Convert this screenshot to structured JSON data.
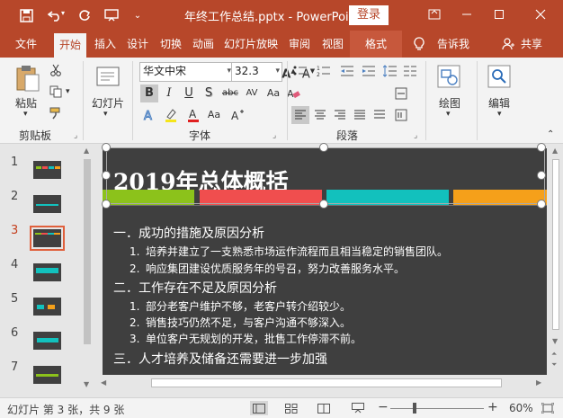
{
  "titlebar": {
    "doc_title": "年终工作总结.pptx  -  PowerPoint",
    "login": "登录",
    "qat_icons": [
      "save-icon",
      "undo-icon",
      "redo-icon",
      "start-slideshow-icon",
      "customize-qat-icon"
    ],
    "window_icons": [
      "ribbon-display-icon",
      "minimize-icon",
      "maximize-icon",
      "close-icon"
    ]
  },
  "tabs": {
    "file": "文件",
    "home": "开始",
    "insert": "插入",
    "design": "设计",
    "transitions": "切换",
    "animations": "动画",
    "slideshow": "幻灯片放映",
    "review": "审阅",
    "view": "视图",
    "format": "格式",
    "tellme": "告诉我",
    "share": "共享"
  },
  "ribbon": {
    "clipboard": {
      "label": "剪贴板",
      "paste": "粘贴"
    },
    "slides": {
      "new_slide": "幻灯片"
    },
    "font": {
      "label": "字体",
      "font_name": "华文中宋",
      "font_size": "32.3",
      "bold": "B",
      "italic": "I",
      "underline": "U",
      "shadow": "S",
      "strike": "abc",
      "spacing": "AV",
      "case": "Aa",
      "clear": "A"
    },
    "paragraph": {
      "label": "段落"
    },
    "drawing": {
      "label": "绘图"
    },
    "editing": {
      "label": "编辑"
    }
  },
  "thumbnails": {
    "numbers": [
      "1",
      "2",
      "3",
      "4",
      "5",
      "6",
      "7"
    ],
    "selected": "3"
  },
  "slide": {
    "title": "2019年总体概括",
    "stripe_colors": [
      "#8cc21b",
      "#f04e4e",
      "#12c1bd",
      "#f5a01a"
    ],
    "sections": [
      {
        "heading": "一．成功的措施及原因分析",
        "items": [
          {
            "n": "1.",
            "text": "培养并建立了一支熟悉市场运作流程而且相当稳定的销售团队。"
          },
          {
            "n": "2.",
            "text": "响应集团建设优质服务年的号召，努力改善服务水平。"
          }
        ]
      },
      {
        "heading": "二．工作存在不足及原因分析",
        "items": [
          {
            "n": "1.",
            "text": "部分老客户维护不够，老客户转介绍较少。"
          },
          {
            "n": "2.",
            "text": "销售技巧仍然不足，与客户沟通不够深入。"
          },
          {
            "n": "3.",
            "text": "单位客户无规划的开发，批售工作停滞不前。"
          }
        ]
      },
      {
        "heading": "三．人才培养及储备还需要进一步加强",
        "items": []
      }
    ]
  },
  "statusbar": {
    "text": "幻灯片 第 3 张，共 9 张",
    "zoom": "60%",
    "zoom_minus": "−",
    "zoom_plus": "+"
  },
  "colors": {
    "accent": "#b7472a",
    "slide_bg": "#3f3f3f",
    "selected_thumb": "#e0603c"
  }
}
